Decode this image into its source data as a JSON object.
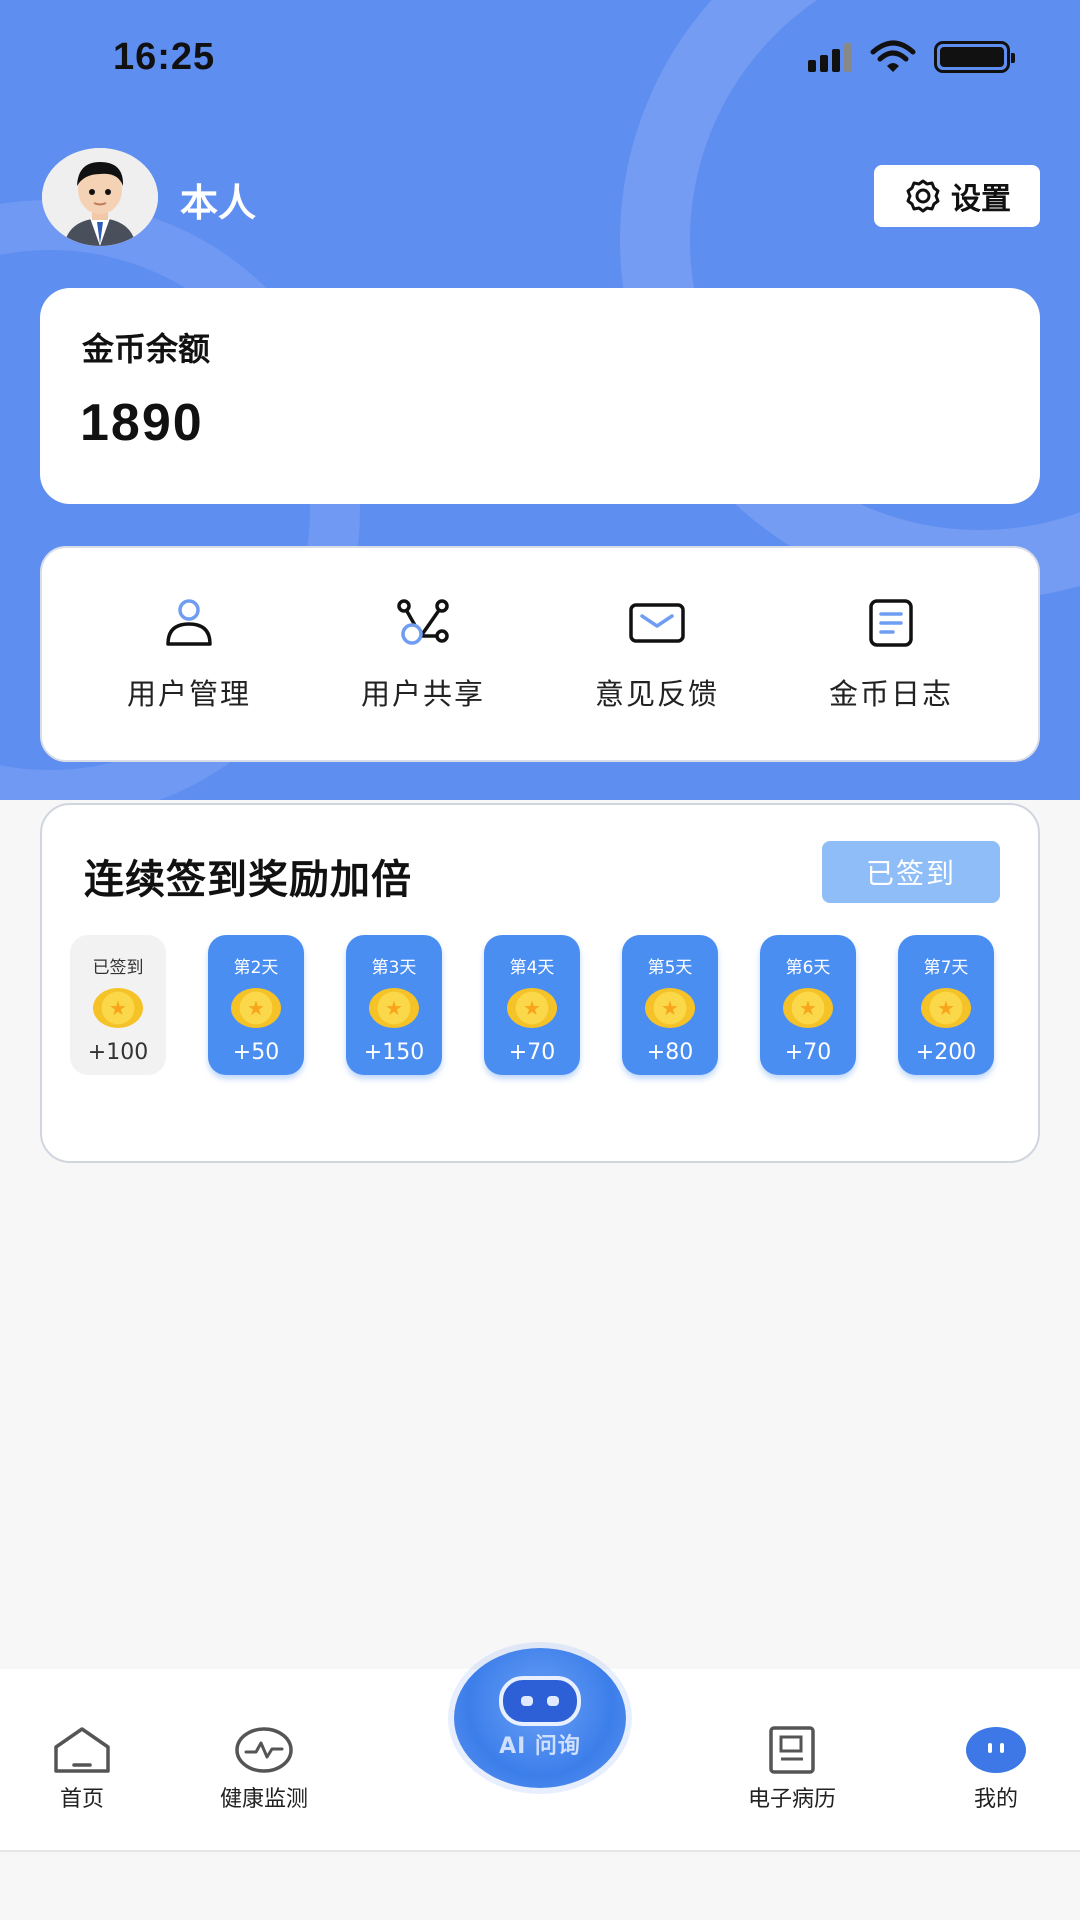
{
  "status_bar": {
    "time": "16:25"
  },
  "profile": {
    "name": "本人",
    "settings_label": "设置"
  },
  "balance": {
    "label": "金币余额",
    "value": "1890"
  },
  "menu": [
    {
      "label": "用户管理",
      "icon": "user-icon"
    },
    {
      "label": "用户共享",
      "icon": "share-icon"
    },
    {
      "label": "意见反馈",
      "icon": "mail-icon"
    },
    {
      "label": "金币日志",
      "icon": "document-icon"
    }
  ],
  "checkin": {
    "title": "连续签到奖励加倍",
    "button_label": "已签到",
    "days": [
      {
        "label": "已签到",
        "amount": "+100",
        "done": true
      },
      {
        "label": "第2天",
        "amount": "+50",
        "done": false
      },
      {
        "label": "第3天",
        "amount": "+150",
        "done": false
      },
      {
        "label": "第4天",
        "amount": "+70",
        "done": false
      },
      {
        "label": "第5天",
        "amount": "+80",
        "done": false
      },
      {
        "label": "第6天",
        "amount": "+70",
        "done": false
      },
      {
        "label": "第7天",
        "amount": "+200",
        "done": false
      }
    ]
  },
  "nav": {
    "home": "首页",
    "health": "健康监测",
    "ai": "AI 问询",
    "records": "电子病历",
    "mine": "我的"
  },
  "colors": {
    "header_blue": "#5f8ef1",
    "day_blue": "#4b8ef1",
    "checked_button": "#8ebdf8",
    "coin_gold": "#f5c227"
  }
}
